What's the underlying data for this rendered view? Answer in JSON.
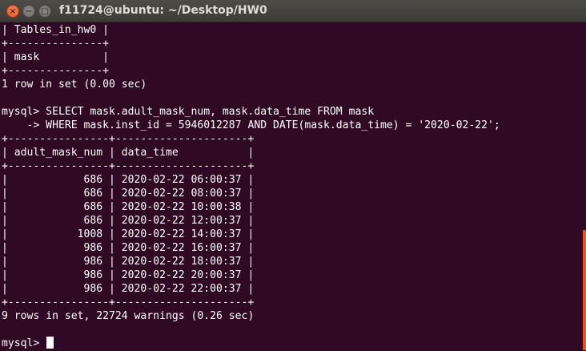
{
  "window": {
    "title": "f11724@ubuntu: ~/Desktop/HW0",
    "close_icon": "×",
    "minimize_icon": "−",
    "maximize_icon": "□"
  },
  "terminal": {
    "prompt": "mysql> ",
    "lines": [
      "| Tables_in_hw0 |",
      "+---------------+",
      "| mask          |",
      "+---------------+",
      "1 row in set (0.00 sec)",
      "",
      "mysql> SELECT mask.adult_mask_num, mask.data_time FROM mask",
      "    -> WHERE mask.inst_id = 5946012287 AND DATE(mask.data_time) = '2020-02-22';",
      "+----------------+---------------------+",
      "| adult_mask_num | data_time           |",
      "+----------------+---------------------+",
      "|            686 | 2020-02-22 06:00:37 |",
      "|            686 | 2020-02-22 08:00:37 |",
      "|            686 | 2020-02-22 10:00:38 |",
      "|            686 | 2020-02-22 12:00:37 |",
      "|           1008 | 2020-02-22 14:00:37 |",
      "|            986 | 2020-02-22 16:00:37 |",
      "|            986 | 2020-02-22 18:00:37 |",
      "|            986 | 2020-02-22 20:00:37 |",
      "|            986 | 2020-02-22 22:00:37 |",
      "+----------------+---------------------+",
      "9 rows in set, 22724 warnings (0.26 sec)",
      ""
    ]
  },
  "scrollbar": {
    "position_fraction": 0.72,
    "thumb_color": "#e95420"
  },
  "colors": {
    "background": "#300a24",
    "text": "#ffffff",
    "close_button": "#e95420"
  }
}
